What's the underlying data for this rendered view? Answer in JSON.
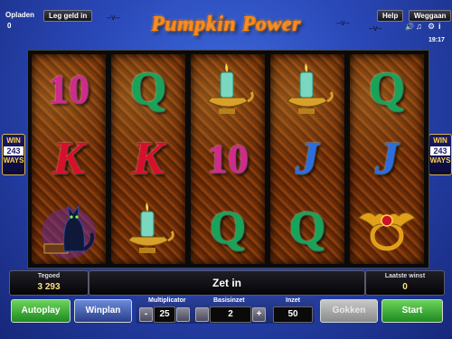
{
  "topbar": {
    "opladen": "Opladen",
    "leg_geld_in": "Leg geld in",
    "credit_counter": "0",
    "help": "Help",
    "weggaan": "Weggaan",
    "clock": "19:17",
    "title": "Pumpkin Power"
  },
  "reels": {
    "columns": [
      [
        "10",
        "K",
        "black-cat"
      ],
      [
        "Q",
        "K",
        "candle-lamp"
      ],
      [
        "candle-lamp",
        "10",
        "Q"
      ],
      [
        "candle-lamp",
        "J",
        "Q"
      ],
      [
        "Q",
        "J",
        "bat-ring"
      ]
    ]
  },
  "ways_badge": {
    "top": "WIN",
    "number": "243",
    "bottom": "WAYS"
  },
  "info": {
    "tegoed_label": "Tegoed",
    "tegoed_value": "3 293",
    "message": "Zet in",
    "laatste_winst_label": "Laatste winst",
    "laatste_winst_value": "0"
  },
  "controls": {
    "autoplay": "Autoplay",
    "winplan": "Winplan",
    "multiplicator_label": "Multiplicator",
    "multiplicator_value": "25",
    "basisinzet_label": "Basisinzet",
    "basisinzet_value": "2",
    "inzet_label": "Inzet",
    "inzet_value": "50",
    "gokken": "Gokken",
    "start": "Start",
    "minus": "-",
    "plus": "+"
  },
  "icons": {
    "sound": "speaker-icon",
    "music": "note-icon",
    "settings": "settings-icon",
    "info": "info-icon"
  }
}
